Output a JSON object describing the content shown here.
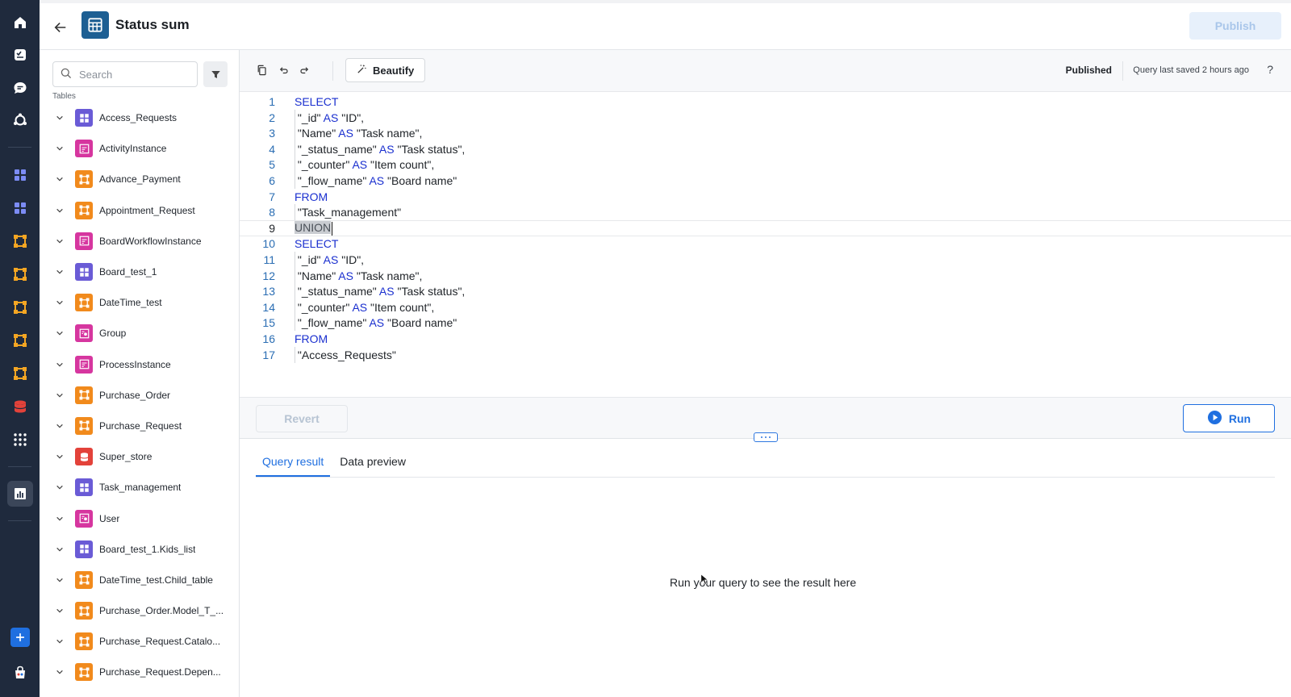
{
  "header": {
    "title": "Status sum",
    "publish_label": "Publish"
  },
  "rail": {
    "items": [
      "home-icon",
      "tasks-icon",
      "chat-icon",
      "integrations-icon",
      "apps-icon",
      "apps-icon",
      "flow-icon",
      "flow-icon",
      "flow-icon",
      "flow-icon",
      "flow-icon",
      "database-icon",
      "grid-menu-icon",
      "analytics-icon"
    ]
  },
  "sidebar": {
    "search_placeholder": "Search",
    "tables_label": "Tables",
    "tables": [
      {
        "name": "Access_Requests",
        "color": "#6a5bd6",
        "icon": "board-icon"
      },
      {
        "name": "ActivityInstance",
        "color": "#d6369f",
        "icon": "process-icon"
      },
      {
        "name": "Advance_Payment",
        "color": "#f18a1c",
        "icon": "flow-icon"
      },
      {
        "name": "Appointment_Request",
        "color": "#f18a1c",
        "icon": "flow-icon"
      },
      {
        "name": "BoardWorkflowInstance",
        "color": "#d6369f",
        "icon": "process-icon"
      },
      {
        "name": "Board_test_1",
        "color": "#6a5bd6",
        "icon": "board-icon"
      },
      {
        "name": "DateTime_test",
        "color": "#f18a1c",
        "icon": "flow-icon"
      },
      {
        "name": "Group",
        "color": "#d6369f",
        "icon": "group-icon"
      },
      {
        "name": "ProcessInstance",
        "color": "#d6369f",
        "icon": "process-icon"
      },
      {
        "name": "Purchase_Order",
        "color": "#f18a1c",
        "icon": "flow-icon"
      },
      {
        "name": "Purchase_Request",
        "color": "#f18a1c",
        "icon": "flow-icon"
      },
      {
        "name": "Super_store",
        "color": "#e3423a",
        "icon": "database-icon"
      },
      {
        "name": "Task_management",
        "color": "#6a5bd6",
        "icon": "board-icon"
      },
      {
        "name": "User",
        "color": "#d6369f",
        "icon": "user-icon"
      },
      {
        "name": "Board_test_1.Kids_list",
        "color": "#6a5bd6",
        "icon": "board-icon"
      },
      {
        "name": "DateTime_test.Child_table",
        "color": "#f18a1c",
        "icon": "flow-icon"
      },
      {
        "name": "Purchase_Order.Model_T_...",
        "color": "#f18a1c",
        "icon": "flow-icon"
      },
      {
        "name": "Purchase_Request.Catalo...",
        "color": "#f18a1c",
        "icon": "flow-icon"
      },
      {
        "name": "Purchase_Request.Depen...",
        "color": "#f18a1c",
        "icon": "flow-icon"
      }
    ]
  },
  "toolbar": {
    "beautify_label": "Beautify",
    "status": "Published",
    "saved_text": "Query last saved 2 hours ago",
    "help": "?"
  },
  "editor": {
    "lines": [
      {
        "n": "1",
        "parts": [
          [
            "kw",
            "SELECT"
          ]
        ]
      },
      {
        "n": "2",
        "parts": [
          [
            "t",
            " \"_id\" "
          ],
          [
            "kw",
            "AS"
          ],
          [
            "t",
            " \"ID\","
          ]
        ]
      },
      {
        "n": "3",
        "parts": [
          [
            "t",
            " \"Name\" "
          ],
          [
            "kw",
            "AS"
          ],
          [
            "t",
            " \"Task name\","
          ]
        ]
      },
      {
        "n": "4",
        "parts": [
          [
            "t",
            " \"_status_name\" "
          ],
          [
            "kw",
            "AS"
          ],
          [
            "t",
            " \"Task status\","
          ]
        ]
      },
      {
        "n": "5",
        "parts": [
          [
            "t",
            " \"_counter\" "
          ],
          [
            "kw",
            "AS"
          ],
          [
            "t",
            " \"Item count\","
          ]
        ]
      },
      {
        "n": "6",
        "parts": [
          [
            "t",
            " \"_flow_name\" "
          ],
          [
            "kw",
            "AS"
          ],
          [
            "t",
            " \"Board name\""
          ]
        ]
      },
      {
        "n": "7",
        "parts": [
          [
            "kw",
            "FROM"
          ]
        ]
      },
      {
        "n": "8",
        "parts": [
          [
            "t",
            " \"Task_management\""
          ]
        ]
      },
      {
        "n": "9",
        "parts": [
          [
            "sel",
            "UNION"
          ]
        ],
        "current": true
      },
      {
        "n": "10",
        "parts": [
          [
            "kw",
            "SELECT"
          ]
        ]
      },
      {
        "n": "11",
        "parts": [
          [
            "t",
            " \"_id\" "
          ],
          [
            "kw",
            "AS"
          ],
          [
            "t",
            " \"ID\","
          ]
        ]
      },
      {
        "n": "12",
        "parts": [
          [
            "t",
            " \"Name\" "
          ],
          [
            "kw",
            "AS"
          ],
          [
            "t",
            " \"Task name\","
          ]
        ]
      },
      {
        "n": "13",
        "parts": [
          [
            "t",
            " \"_status_name\" "
          ],
          [
            "kw",
            "AS"
          ],
          [
            "t",
            " \"Task status\","
          ]
        ]
      },
      {
        "n": "14",
        "parts": [
          [
            "t",
            " \"_counter\" "
          ],
          [
            "kw",
            "AS"
          ],
          [
            "t",
            " \"Item count\","
          ]
        ]
      },
      {
        "n": "15",
        "parts": [
          [
            "t",
            " \"_flow_name\" "
          ],
          [
            "kw",
            "AS"
          ],
          [
            "t",
            " \"Board name\""
          ]
        ]
      },
      {
        "n": "16",
        "parts": [
          [
            "kw",
            "FROM"
          ]
        ]
      },
      {
        "n": "17",
        "parts": [
          [
            "t",
            " \"Access_Requests\""
          ]
        ]
      }
    ]
  },
  "actions": {
    "revert_label": "Revert",
    "run_label": "Run"
  },
  "results": {
    "tabs": [
      {
        "label": "Query result",
        "active": true
      },
      {
        "label": "Data preview",
        "active": false
      }
    ],
    "empty_text": "Run your query to see the result here"
  },
  "colors": {
    "accent": "#1f6fe0",
    "rail_bg": "#1f2a3d",
    "keyword": "#1a2fcf"
  }
}
